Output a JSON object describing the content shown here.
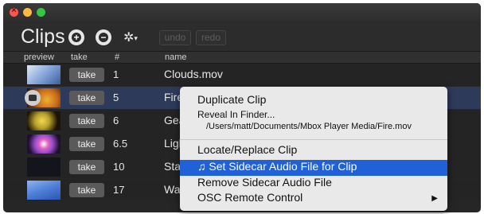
{
  "app": {
    "title": "Clips",
    "undo_label": "undo",
    "redo_label": "redo",
    "add_icon": "plus-icon",
    "remove_icon": "minus-icon",
    "settings_icon": "gear-icon"
  },
  "table": {
    "headers": [
      "preview",
      "take",
      "#",
      "name"
    ],
    "rows": [
      {
        "take": "take",
        "num": "1",
        "name": "Clouds.mov",
        "thumb": "#7e9fd4"
      },
      {
        "take": "take",
        "num": "5",
        "name": "Fire",
        "thumb": "#c86a1a"
      },
      {
        "take": "take",
        "num": "6",
        "name": "Gea",
        "thumb": "#b8a12e"
      },
      {
        "take": "take",
        "num": "6.5",
        "name": "Ligh",
        "thumb": "#9c4fd0"
      },
      {
        "take": "take",
        "num": "10",
        "name": "Star",
        "thumb": "#1a1a22"
      },
      {
        "take": "take",
        "num": "17",
        "name": "Wat",
        "thumb": "#4f7ed6"
      }
    ]
  },
  "context_menu": {
    "items": [
      "Duplicate Clip",
      "Reveal In Finder...",
      "/Users/matt/Documents/Mbox Player Media/Fire.mov",
      "Locate/Replace Clip",
      "♫ Set Sidecar Audio File for Clip",
      "Remove Sidecar Audio File",
      "OSC Remote Control"
    ],
    "submenu_arrow": "▶"
  },
  "colors": {
    "highlight": "#2061d8",
    "window_bg": "#262626"
  }
}
